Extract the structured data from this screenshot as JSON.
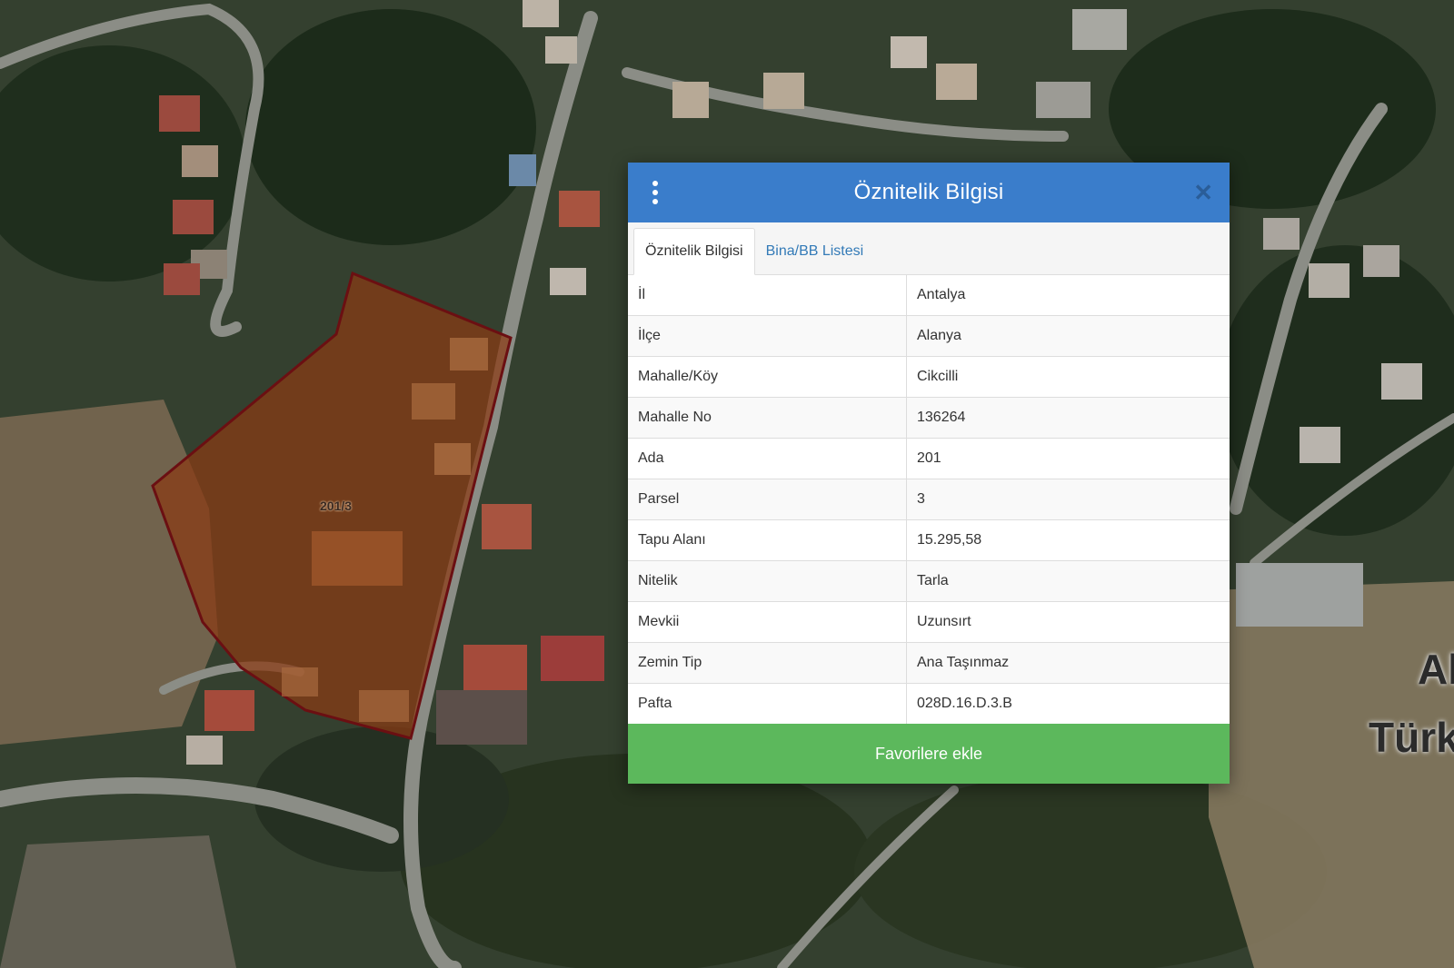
{
  "map": {
    "parcel_label": "201/3",
    "city_label_line1": "Ala",
    "city_label_line2": "Türk"
  },
  "panel": {
    "title": "Öznitelik Bilgisi",
    "menu_icon": "vertical-dots-icon",
    "close_icon": "close-icon",
    "tabs": [
      {
        "label": "Öznitelik Bilgisi",
        "active": true
      },
      {
        "label": "Bina/BB Listesi",
        "active": false
      }
    ],
    "rows": [
      {
        "key": "İl",
        "value": "Antalya"
      },
      {
        "key": "İlçe",
        "value": "Alanya"
      },
      {
        "key": "Mahalle/Köy",
        "value": "Cikcilli"
      },
      {
        "key": "Mahalle No",
        "value": "136264"
      },
      {
        "key": "Ada",
        "value": "201"
      },
      {
        "key": "Parsel",
        "value": "3"
      },
      {
        "key": "Tapu Alanı",
        "value": "15.295,58"
      },
      {
        "key": "Nitelik",
        "value": "Tarla"
      },
      {
        "key": "Mevkii",
        "value": "Uzunsırt"
      },
      {
        "key": "Zemin Tip",
        "value": "Ana Taşınmaz"
      },
      {
        "key": "Pafta",
        "value": "028D.16.D.3.B"
      }
    ],
    "favorite_button": "Favorilere ekle"
  },
  "colors": {
    "header_blue": "#3a7dcb",
    "button_green": "#5cb85c",
    "parcel_fill": "#8a3a14",
    "parcel_border": "#6b0f12"
  }
}
